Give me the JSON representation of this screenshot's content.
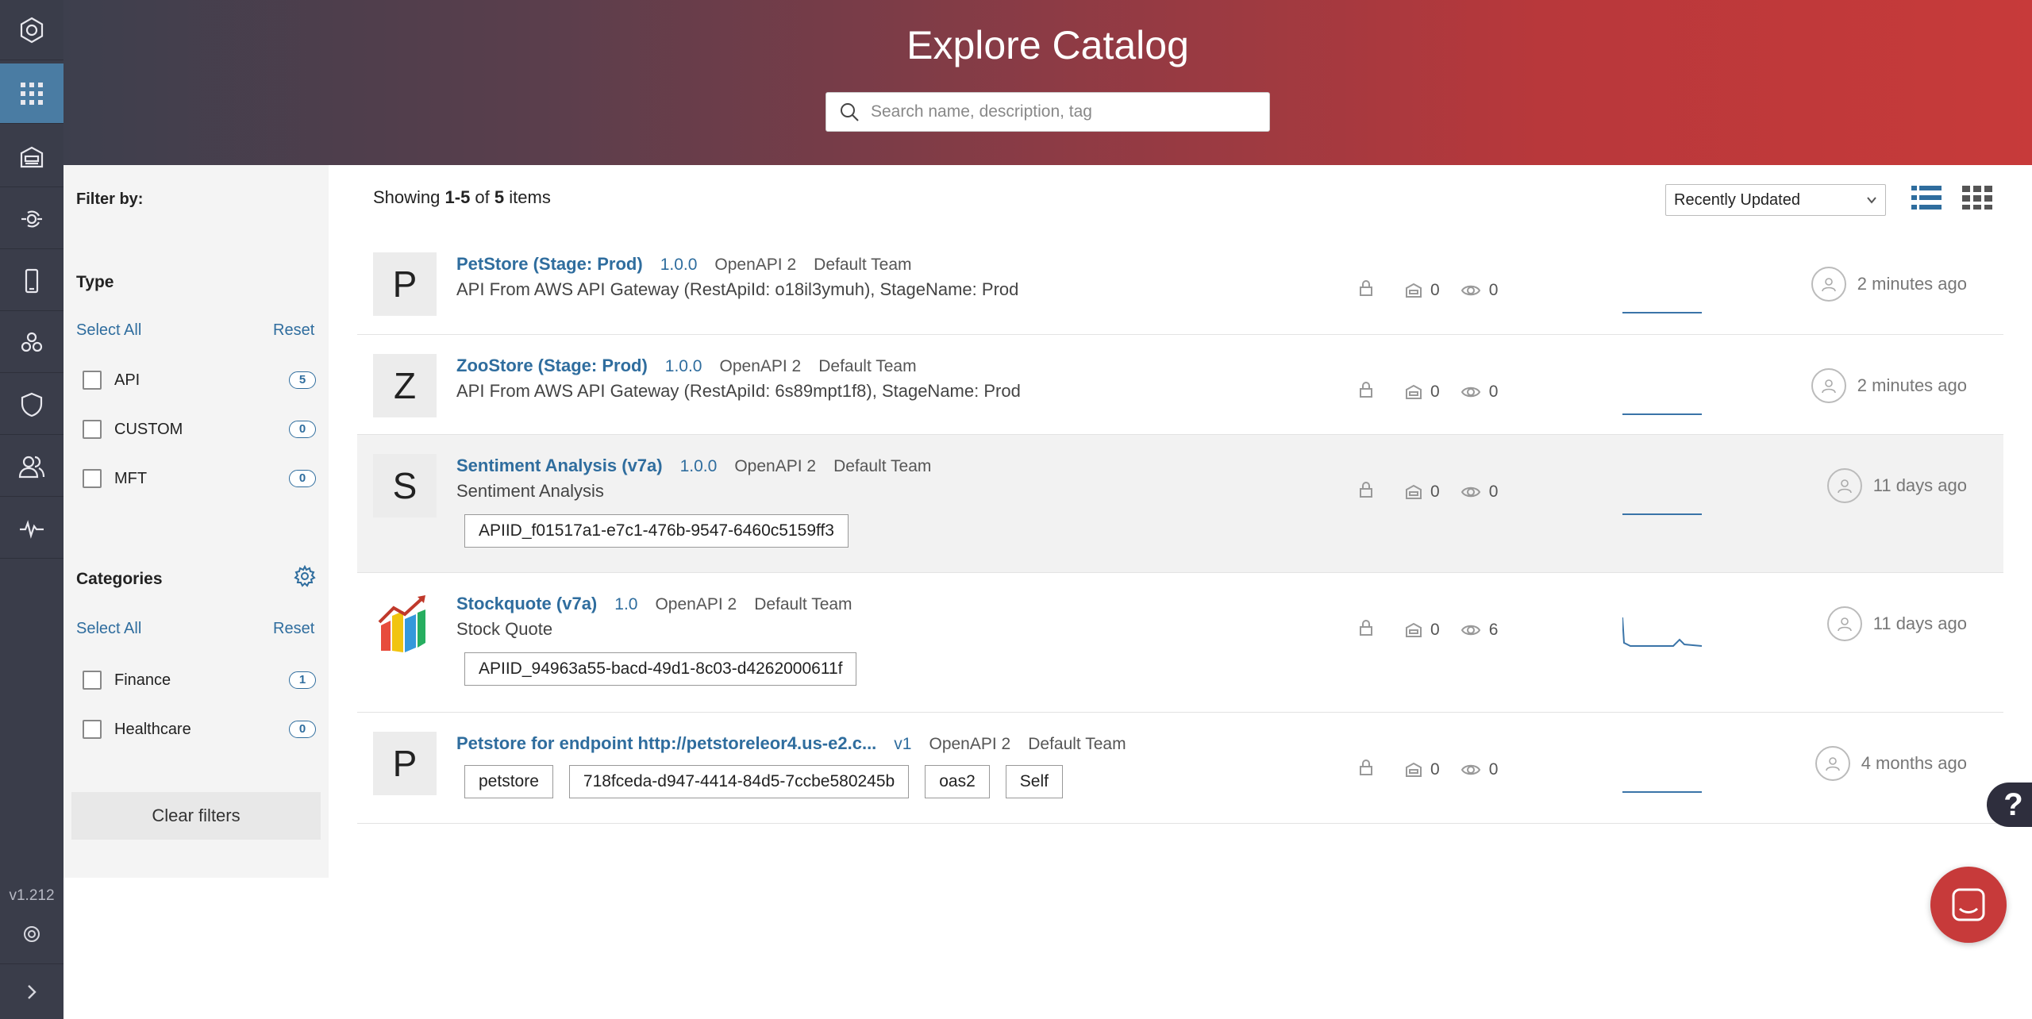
{
  "header": {
    "title": "Explore Catalog",
    "search_placeholder": "Search name, description, tag"
  },
  "rail": {
    "version": "v1.212"
  },
  "filters": {
    "filter_by": "Filter by:",
    "type_heading": "Type",
    "select_all": "Select All",
    "reset": "Reset",
    "types": [
      {
        "label": "API",
        "count": "5"
      },
      {
        "label": "CUSTOM",
        "count": "0"
      },
      {
        "label": "MFT",
        "count": "0"
      }
    ],
    "categories_heading": "Categories",
    "categories": [
      {
        "label": "Finance",
        "count": "1"
      },
      {
        "label": "Healthcare",
        "count": "0"
      }
    ],
    "clear": "Clear filters"
  },
  "listing": {
    "showing_prefix": "Showing ",
    "range": "1-5",
    "of": " of ",
    "total": "5",
    "suffix": " items",
    "sort_selected": "Recently Updated"
  },
  "items": [
    {
      "thumb": "P",
      "name": "PetStore (Stage: Prod)",
      "version": "1.0.0",
      "spec": "OpenAPI 2",
      "team": "Default Team",
      "description": "API From AWS API Gateway (RestApiId: o18il3ymuh), StageName: Prod",
      "subs": "0",
      "views": "0",
      "updated": "2 minutes ago",
      "tags": []
    },
    {
      "thumb": "Z",
      "name": "ZooStore (Stage: Prod)",
      "version": "1.0.0",
      "spec": "OpenAPI 2",
      "team": "Default Team",
      "description": "API From AWS API Gateway (RestApiId: 6s89mpt1f8), StageName: Prod",
      "subs": "0",
      "views": "0",
      "updated": "2 minutes ago",
      "tags": []
    },
    {
      "thumb": "S",
      "name": "Sentiment Analysis (v7a)",
      "version": "1.0.0",
      "spec": "OpenAPI 2",
      "team": "Default Team",
      "description": "Sentiment Analysis",
      "subs": "0",
      "views": "0",
      "updated": "11 days ago",
      "tags": [
        "APIID_f01517a1-e7c1-476b-9547-6460c5159ff3"
      ]
    },
    {
      "thumb": "",
      "name": "Stockquote (v7a)",
      "version": "1.0",
      "spec": "OpenAPI 2",
      "team": "Default Team",
      "description": "Stock Quote",
      "subs": "0",
      "views": "6",
      "updated": "11 days ago",
      "tags": [
        "APIID_94963a55-bacd-49d1-8c03-d4262000611f"
      ]
    },
    {
      "thumb": "P",
      "name": "Petstore for endpoint http://petstoreleor4.us-e2.c...",
      "version": "v1",
      "spec": "OpenAPI 2",
      "team": "Default Team",
      "description": "",
      "subs": "0",
      "views": "0",
      "updated": "4 months ago",
      "tags": [
        "petstore",
        "718fceda-d947-4414-84d5-7ccbe580245b",
        "oas2",
        "Self"
      ]
    }
  ],
  "icons": {
    "rail": [
      "logo-icon",
      "catalog-grid-icon",
      "garage-icon",
      "api-connect-icon",
      "mobile-icon",
      "apps-icon",
      "shield-icon",
      "users-icon",
      "activity-icon"
    ],
    "help": "?"
  },
  "colors": {
    "accent": "#2f6d9e",
    "brand_red": "#c73a3a",
    "rail": "#3a3d4a"
  }
}
